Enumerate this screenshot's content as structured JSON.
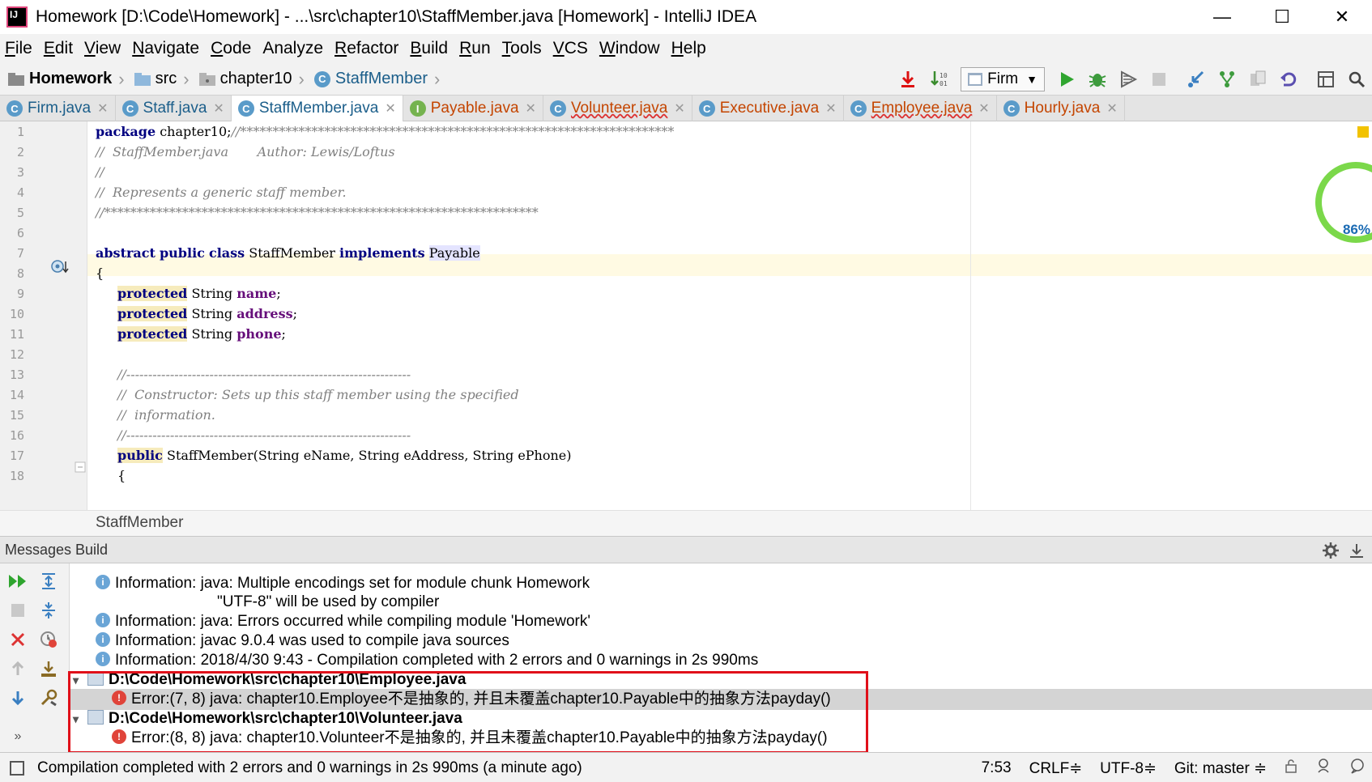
{
  "window": {
    "title": "Homework [D:\\Code\\Homework] - ...\\src\\chapter10\\StaffMember.java [Homework] - IntelliJ IDEA",
    "minimize": "—",
    "maximize": "☐",
    "close": "✕"
  },
  "menu": [
    {
      "u": "F",
      "rest": "ile"
    },
    {
      "u": "E",
      "rest": "dit"
    },
    {
      "u": "V",
      "rest": "iew"
    },
    {
      "u": "N",
      "rest": "avigate"
    },
    {
      "u": "C",
      "rest": "ode"
    },
    {
      "u": "",
      "rest": "Analyze"
    },
    {
      "u": "R",
      "rest": "efactor"
    },
    {
      "u": "B",
      "rest": "uild"
    },
    {
      "u": "R",
      "rest": "un"
    },
    {
      "u": "T",
      "rest": "ools"
    },
    {
      "u": "V",
      "rest": "CS"
    },
    {
      "u": "W",
      "rest": "indow"
    },
    {
      "u": "H",
      "rest": "elp"
    }
  ],
  "breadcrumb": {
    "project": "Homework",
    "src": "src",
    "package": "chapter10",
    "class": "StaffMember"
  },
  "run_config": "Firm",
  "tabs": [
    {
      "label": "Firm.java",
      "icon": "C",
      "style": "blue"
    },
    {
      "label": "Staff.java",
      "icon": "C",
      "style": "blue"
    },
    {
      "label": "StaffMember.java",
      "icon": "C",
      "style": "blue"
    },
    {
      "label": "Payable.java",
      "icon": "I",
      "style": "norm"
    },
    {
      "label": "Volunteer.java",
      "icon": "C",
      "style": "err"
    },
    {
      "label": "Executive.java",
      "icon": "C",
      "style": "norm"
    },
    {
      "label": "Employee.java",
      "icon": "C",
      "style": "err"
    },
    {
      "label": "Hourly.java",
      "icon": "C",
      "style": "norm"
    }
  ],
  "editor": {
    "line_numbers": [
      "1",
      "2",
      "3",
      "4",
      "5",
      "6",
      "7",
      "8",
      "9",
      "10",
      "11",
      "12",
      "13",
      "14",
      "15",
      "16",
      "17",
      "18"
    ],
    "l1_kw": "package",
    "l1_rest": " chapter10;",
    "l1_cm": "//*******************************************************************",
    "l2": "//  StaffMember.java       Author: Lewis/Loftus",
    "l3": "//",
    "l4": "//  Represents a generic staff member.",
    "l5": "//*******************************************************************",
    "l7_kw1": "abstract",
    "l7_kw2": "public",
    "l7_kw3": "class",
    "l7_name": " StaffMember ",
    "l7_kw4": "implements",
    "l7_iface": "Payable",
    "l8": "{",
    "protected_kw": "protected",
    "string_type": " String ",
    "l9_field": "name",
    "l10_field": "address",
    "l11_field": "phone",
    "semicolon": ";",
    "l13": "//-----------------------------------------------------------------",
    "l14": "//  Constructor: Sets up this staff member using the specified",
    "l15": "//  information.",
    "l16": "//-----------------------------------------------------------------",
    "l17_kw": "public",
    "l17_rest": " StaffMember(String eName, String eAddress, String ePhone)",
    "l18": "{",
    "gauge": "86%"
  },
  "structure_label": "StaffMember",
  "messages": {
    "header": "Messages Build",
    "rows": [
      "Information: java: Multiple encodings set for module chunk Homework",
      "\"UTF-8\" will be used by compiler",
      "Information: java: Errors occurred while compiling module 'Homework'",
      "Information: javac 9.0.4 was used to compile java sources",
      "Information: 2018/4/30 9:43 - Compilation completed with 2 errors and 0 warnings in 2s 990ms",
      "D:\\Code\\Homework\\src\\chapter10\\Employee.java",
      "Error:(7, 8)  java: chapter10.Employee不是抽象的, 并且未覆盖chapter10.Payable中的抽象方法payday()",
      "D:\\Code\\Homework\\src\\chapter10\\Volunteer.java",
      "Error:(8, 8)  java: chapter10.Volunteer不是抽象的, 并且未覆盖chapter10.Payable中的抽象方法payday()"
    ]
  },
  "status": {
    "message": "Compilation completed with 2 errors and 0 warnings in 2s 990ms (a minute ago)",
    "position": "7:53",
    "line_sep": "CRLF≑",
    "encoding": "UTF-8≑",
    "vcs": "Git: master ≑"
  }
}
